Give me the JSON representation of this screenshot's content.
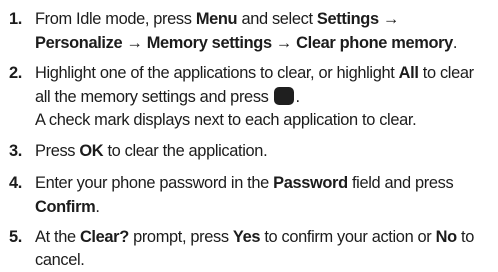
{
  "steps": [
    {
      "number": "1.",
      "lines": [
        [
          "From Idle mode, press ",
          "Menu",
          " and select ",
          "Settings",
          " →"
        ],
        [
          "Personalize",
          " → ",
          "Memory settings",
          " → ",
          "Clear phone memory",
          "."
        ]
      ]
    },
    {
      "number": "2.",
      "lines": [
        [
          "Highlight one of the applications to clear, or highlight ",
          "All",
          " to clear"
        ],
        [
          "all the memory settings and press",
          "."
        ],
        [
          "A check mark displays next to each application to clear."
        ]
      ]
    },
    {
      "number": "3.",
      "lines": [
        [
          "Press ",
          "OK",
          " to clear the application."
        ]
      ]
    },
    {
      "number": "4.",
      "lines": [
        [
          "Enter your phone password in the ",
          "Password",
          " field and press"
        ],
        [
          "Confirm",
          "."
        ]
      ]
    },
    {
      "number": "5.",
      "lines": [
        [
          "At the ",
          "Clear?",
          " prompt, press ",
          "Yes",
          " to confirm your action or ",
          "No",
          " to"
        ],
        [
          "cancel."
        ]
      ]
    }
  ],
  "icons": {
    "step2_key": "phone-select-key-icon"
  }
}
